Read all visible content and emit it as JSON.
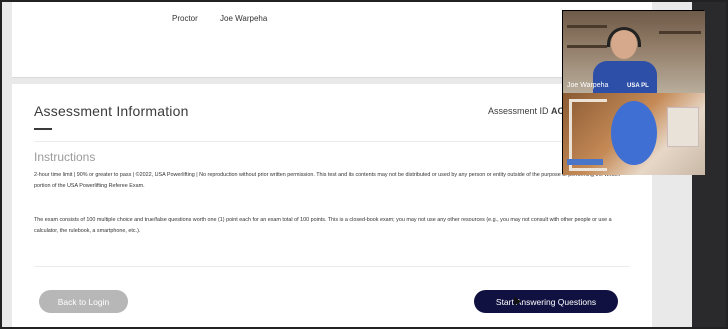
{
  "proctor": {
    "label": "Proctor",
    "name": "Joe Warpeha"
  },
  "assessment": {
    "title": "Assessment Information",
    "id_label": "Assessment ID",
    "id_value": "AC"
  },
  "instructions": {
    "heading": "Instructions",
    "paragraph1": "2-hour time limit | 90% or greater to pass | ©2022, USA Powerlifting | No reproduction without prior written permission. This test and its contents may not be distributed or used by any person or entity outside of the purpose of performing the written portion of the USA Powerlifting Referee Exam.",
    "paragraph2": "The exam consists of 100 multiple choice and true/false questions worth one (1) point each for an exam total of 100 points. This is a closed-book exam; you may not use any other resources (e.g., you may not consult with other people or use a calculator, the rulebook, a smartphone, etc.)."
  },
  "buttons": {
    "back": "Back to Login",
    "start": "Start Answering Questions"
  },
  "video": {
    "participant_name": "Joe Warpeha",
    "shirt_text": "USA PL"
  },
  "colors": {
    "start_button": "#101140",
    "back_button": "#b7b7b7"
  }
}
